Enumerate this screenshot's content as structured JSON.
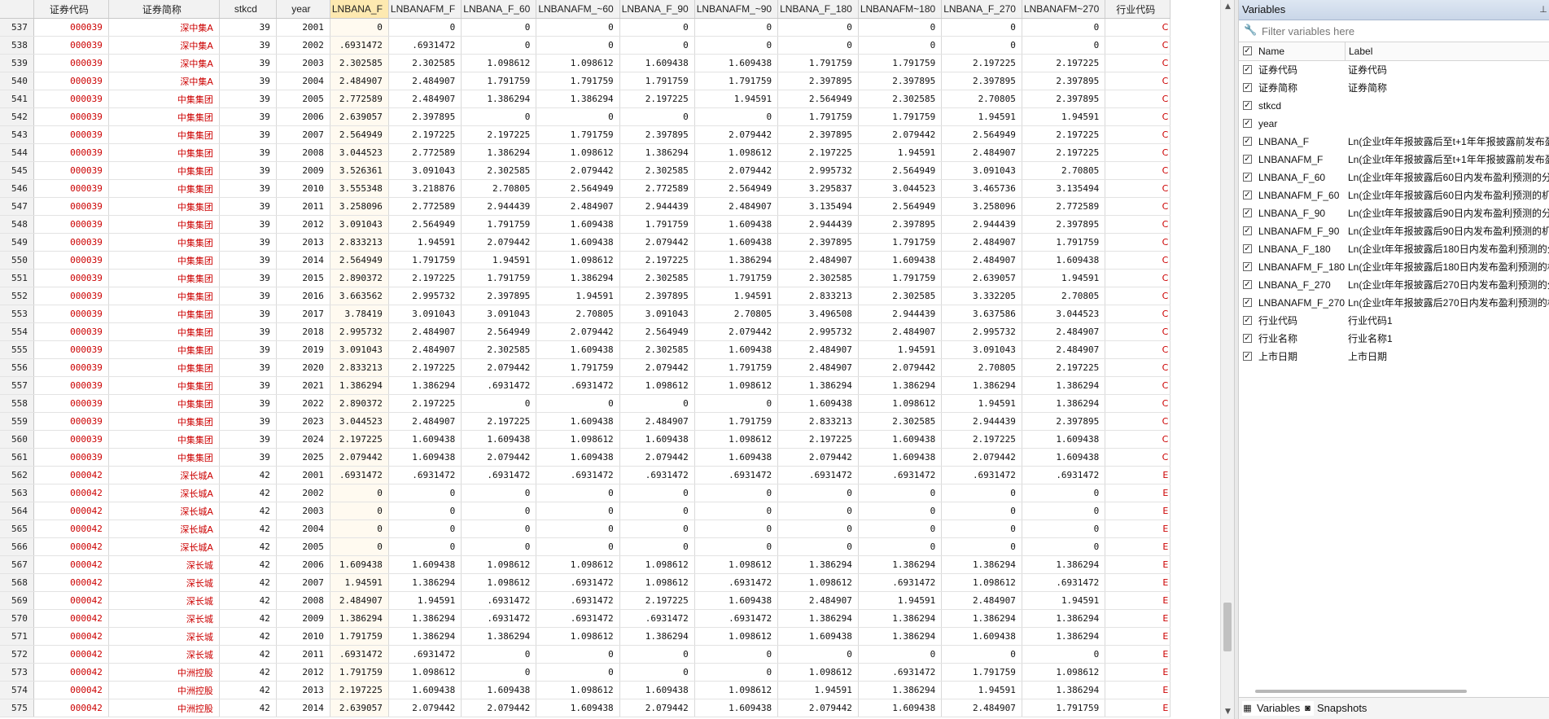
{
  "grid": {
    "columns": [
      "证券代码",
      "证券简称",
      "stkcd",
      "year",
      "LNBANA_F",
      "LNBANAFM_F",
      "LNBANA_F_60",
      "LNBANAFM_~60",
      "LNBANA_F_90",
      "LNBANAFM_~90",
      "LNBANA_F_180",
      "LNBANAFM~180",
      "LNBANA_F_270",
      "LNBANAFM~270",
      "行业代码"
    ],
    "selected_column": 4,
    "rows": [
      [
        "537",
        "000039",
        "深中集A",
        "39",
        "2001",
        "0",
        "0",
        "0",
        "0",
        "0",
        "0",
        "0",
        "0",
        "0",
        "0",
        "C"
      ],
      [
        "538",
        "000039",
        "深中集A",
        "39",
        "2002",
        ".6931472",
        ".6931472",
        "0",
        "0",
        "0",
        "0",
        "0",
        "0",
        "0",
        "0",
        "C"
      ],
      [
        "539",
        "000039",
        "深中集A",
        "39",
        "2003",
        "2.302585",
        "2.302585",
        "1.098612",
        "1.098612",
        "1.609438",
        "1.609438",
        "1.791759",
        "1.791759",
        "2.197225",
        "2.197225",
        "C"
      ],
      [
        "540",
        "000039",
        "深中集A",
        "39",
        "2004",
        "2.484907",
        "2.484907",
        "1.791759",
        "1.791759",
        "1.791759",
        "1.791759",
        "2.397895",
        "2.397895",
        "2.397895",
        "2.397895",
        "C"
      ],
      [
        "541",
        "000039",
        "中集集团",
        "39",
        "2005",
        "2.772589",
        "2.484907",
        "1.386294",
        "1.386294",
        "2.197225",
        "1.94591",
        "2.564949",
        "2.302585",
        "2.70805",
        "2.397895",
        "C"
      ],
      [
        "542",
        "000039",
        "中集集团",
        "39",
        "2006",
        "2.639057",
        "2.397895",
        "0",
        "0",
        "0",
        "0",
        "1.791759",
        "1.791759",
        "1.94591",
        "1.94591",
        "C"
      ],
      [
        "543",
        "000039",
        "中集集团",
        "39",
        "2007",
        "2.564949",
        "2.197225",
        "2.197225",
        "1.791759",
        "2.397895",
        "2.079442",
        "2.397895",
        "2.079442",
        "2.564949",
        "2.197225",
        "C"
      ],
      [
        "544",
        "000039",
        "中集集团",
        "39",
        "2008",
        "3.044523",
        "2.772589",
        "1.386294",
        "1.098612",
        "1.386294",
        "1.098612",
        "2.197225",
        "1.94591",
        "2.484907",
        "2.197225",
        "C"
      ],
      [
        "545",
        "000039",
        "中集集团",
        "39",
        "2009",
        "3.526361",
        "3.091043",
        "2.302585",
        "2.079442",
        "2.302585",
        "2.079442",
        "2.995732",
        "2.564949",
        "3.091043",
        "2.70805",
        "C"
      ],
      [
        "546",
        "000039",
        "中集集团",
        "39",
        "2010",
        "3.555348",
        "3.218876",
        "2.70805",
        "2.564949",
        "2.772589",
        "2.564949",
        "3.295837",
        "3.044523",
        "3.465736",
        "3.135494",
        "C"
      ],
      [
        "547",
        "000039",
        "中集集团",
        "39",
        "2011",
        "3.258096",
        "2.772589",
        "2.944439",
        "2.484907",
        "2.944439",
        "2.484907",
        "3.135494",
        "2.564949",
        "3.258096",
        "2.772589",
        "C"
      ],
      [
        "548",
        "000039",
        "中集集团",
        "39",
        "2012",
        "3.091043",
        "2.564949",
        "1.791759",
        "1.609438",
        "1.791759",
        "1.609438",
        "2.944439",
        "2.397895",
        "2.944439",
        "2.397895",
        "C"
      ],
      [
        "549",
        "000039",
        "中集集团",
        "39",
        "2013",
        "2.833213",
        "1.94591",
        "2.079442",
        "1.609438",
        "2.079442",
        "1.609438",
        "2.397895",
        "1.791759",
        "2.484907",
        "1.791759",
        "C"
      ],
      [
        "550",
        "000039",
        "中集集团",
        "39",
        "2014",
        "2.564949",
        "1.791759",
        "1.94591",
        "1.098612",
        "2.197225",
        "1.386294",
        "2.484907",
        "1.609438",
        "2.484907",
        "1.609438",
        "C"
      ],
      [
        "551",
        "000039",
        "中集集团",
        "39",
        "2015",
        "2.890372",
        "2.197225",
        "1.791759",
        "1.386294",
        "2.302585",
        "1.791759",
        "2.302585",
        "1.791759",
        "2.639057",
        "1.94591",
        "C"
      ],
      [
        "552",
        "000039",
        "中集集团",
        "39",
        "2016",
        "3.663562",
        "2.995732",
        "2.397895",
        "1.94591",
        "2.397895",
        "1.94591",
        "2.833213",
        "2.302585",
        "3.332205",
        "2.70805",
        "C"
      ],
      [
        "553",
        "000039",
        "中集集团",
        "39",
        "2017",
        "3.78419",
        "3.091043",
        "3.091043",
        "2.70805",
        "3.091043",
        "2.70805",
        "3.496508",
        "2.944439",
        "3.637586",
        "3.044523",
        "C"
      ],
      [
        "554",
        "000039",
        "中集集团",
        "39",
        "2018",
        "2.995732",
        "2.484907",
        "2.564949",
        "2.079442",
        "2.564949",
        "2.079442",
        "2.995732",
        "2.484907",
        "2.995732",
        "2.484907",
        "C"
      ],
      [
        "555",
        "000039",
        "中集集团",
        "39",
        "2019",
        "3.091043",
        "2.484907",
        "2.302585",
        "1.609438",
        "2.302585",
        "1.609438",
        "2.484907",
        "1.94591",
        "3.091043",
        "2.484907",
        "C"
      ],
      [
        "556",
        "000039",
        "中集集团",
        "39",
        "2020",
        "2.833213",
        "2.197225",
        "2.079442",
        "1.791759",
        "2.079442",
        "1.791759",
        "2.484907",
        "2.079442",
        "2.70805",
        "2.197225",
        "C"
      ],
      [
        "557",
        "000039",
        "中集集团",
        "39",
        "2021",
        "1.386294",
        "1.386294",
        ".6931472",
        ".6931472",
        "1.098612",
        "1.098612",
        "1.386294",
        "1.386294",
        "1.386294",
        "1.386294",
        "C"
      ],
      [
        "558",
        "000039",
        "中集集团",
        "39",
        "2022",
        "2.890372",
        "2.197225",
        "0",
        "0",
        "0",
        "0",
        "1.609438",
        "1.098612",
        "1.94591",
        "1.386294",
        "C"
      ],
      [
        "559",
        "000039",
        "中集集团",
        "39",
        "2023",
        "3.044523",
        "2.484907",
        "2.197225",
        "1.609438",
        "2.484907",
        "1.791759",
        "2.833213",
        "2.302585",
        "2.944439",
        "2.397895",
        "C"
      ],
      [
        "560",
        "000039",
        "中集集团",
        "39",
        "2024",
        "2.197225",
        "1.609438",
        "1.609438",
        "1.098612",
        "1.609438",
        "1.098612",
        "2.197225",
        "1.609438",
        "2.197225",
        "1.609438",
        "C"
      ],
      [
        "561",
        "000039",
        "中集集团",
        "39",
        "2025",
        "2.079442",
        "1.609438",
        "2.079442",
        "1.609438",
        "2.079442",
        "1.609438",
        "2.079442",
        "1.609438",
        "2.079442",
        "1.609438",
        "C"
      ],
      [
        "562",
        "000042",
        "深长城A",
        "42",
        "2001",
        ".6931472",
        ".6931472",
        ".6931472",
        ".6931472",
        ".6931472",
        ".6931472",
        ".6931472",
        ".6931472",
        ".6931472",
        ".6931472",
        "E"
      ],
      [
        "563",
        "000042",
        "深长城A",
        "42",
        "2002",
        "0",
        "0",
        "0",
        "0",
        "0",
        "0",
        "0",
        "0",
        "0",
        "0",
        "E"
      ],
      [
        "564",
        "000042",
        "深长城A",
        "42",
        "2003",
        "0",
        "0",
        "0",
        "0",
        "0",
        "0",
        "0",
        "0",
        "0",
        "0",
        "E"
      ],
      [
        "565",
        "000042",
        "深长城A",
        "42",
        "2004",
        "0",
        "0",
        "0",
        "0",
        "0",
        "0",
        "0",
        "0",
        "0",
        "0",
        "E"
      ],
      [
        "566",
        "000042",
        "深长城A",
        "42",
        "2005",
        "0",
        "0",
        "0",
        "0",
        "0",
        "0",
        "0",
        "0",
        "0",
        "0",
        "E"
      ],
      [
        "567",
        "000042",
        "深长城",
        "42",
        "2006",
        "1.609438",
        "1.609438",
        "1.098612",
        "1.098612",
        "1.098612",
        "1.098612",
        "1.386294",
        "1.386294",
        "1.386294",
        "1.386294",
        "E"
      ],
      [
        "568",
        "000042",
        "深长城",
        "42",
        "2007",
        "1.94591",
        "1.386294",
        "1.098612",
        ".6931472",
        "1.098612",
        ".6931472",
        "1.098612",
        ".6931472",
        "1.098612",
        ".6931472",
        "E"
      ],
      [
        "569",
        "000042",
        "深长城",
        "42",
        "2008",
        "2.484907",
        "1.94591",
        ".6931472",
        ".6931472",
        "2.197225",
        "1.609438",
        "2.484907",
        "1.94591",
        "2.484907",
        "1.94591",
        "E"
      ],
      [
        "570",
        "000042",
        "深长城",
        "42",
        "2009",
        "1.386294",
        "1.386294",
        ".6931472",
        ".6931472",
        ".6931472",
        ".6931472",
        "1.386294",
        "1.386294",
        "1.386294",
        "1.386294",
        "E"
      ],
      [
        "571",
        "000042",
        "深长城",
        "42",
        "2010",
        "1.791759",
        "1.386294",
        "1.386294",
        "1.098612",
        "1.386294",
        "1.098612",
        "1.609438",
        "1.386294",
        "1.609438",
        "1.386294",
        "E"
      ],
      [
        "572",
        "000042",
        "深长城",
        "42",
        "2011",
        ".6931472",
        ".6931472",
        "0",
        "0",
        "0",
        "0",
        "0",
        "0",
        "0",
        "0",
        "E"
      ],
      [
        "573",
        "000042",
        "中洲控股",
        "42",
        "2012",
        "1.791759",
        "1.098612",
        "0",
        "0",
        "0",
        "0",
        "1.098612",
        ".6931472",
        "1.791759",
        "1.098612",
        "E"
      ],
      [
        "574",
        "000042",
        "中洲控股",
        "42",
        "2013",
        "2.197225",
        "1.609438",
        "1.609438",
        "1.098612",
        "1.609438",
        "1.098612",
        "1.94591",
        "1.386294",
        "1.94591",
        "1.386294",
        "E"
      ],
      [
        "575",
        "000042",
        "中洲控股",
        "42",
        "2014",
        "2.639057",
        "2.079442",
        "2.079442",
        "1.609438",
        "2.079442",
        "1.609438",
        "2.079442",
        "1.609438",
        "2.484907",
        "1.791759",
        "E"
      ]
    ]
  },
  "variables_panel": {
    "title": "Variables",
    "pin_glyph": "📌",
    "filter_placeholder": "Filter variables here",
    "header": {
      "name": "Name",
      "label": "Label"
    },
    "items": [
      {
        "name": "证券代码",
        "label": "证券代码"
      },
      {
        "name": "证券简称",
        "label": "证券简称"
      },
      {
        "name": "stkcd",
        "label": ""
      },
      {
        "name": "year",
        "label": ""
      },
      {
        "name": "LNBANA_F",
        "label": "Ln(企业t年年报披露后至t+1年年报披露前发布盈"
      },
      {
        "name": "LNBANAFM_F",
        "label": "Ln(企业t年年报披露后至t+1年年报披露前发布盈"
      },
      {
        "name": "LNBANA_F_60",
        "label": "Ln(企业t年年报披露后60日内发布盈利预测的分"
      },
      {
        "name": "LNBANAFM_F_60",
        "label": "Ln(企业t年年报披露后60日内发布盈利预测的机"
      },
      {
        "name": "LNBANA_F_90",
        "label": "Ln(企业t年年报披露后90日内发布盈利预测的分"
      },
      {
        "name": "LNBANAFM_F_90",
        "label": "Ln(企业t年年报披露后90日内发布盈利预测的机"
      },
      {
        "name": "LNBANA_F_180",
        "label": "Ln(企业t年年报披露后180日内发布盈利预测的分"
      },
      {
        "name": "LNBANAFM_F_180",
        "label": "Ln(企业t年年报披露后180日内发布盈利预测的机"
      },
      {
        "name": "LNBANA_F_270",
        "label": "Ln(企业t年年报披露后270日内发布盈利预测的分"
      },
      {
        "name": "LNBANAFM_F_270",
        "label": "Ln(企业t年年报披露后270日内发布盈利预测的机"
      },
      {
        "name": "行业代码",
        "label": "行业代码1"
      },
      {
        "name": "行业名称",
        "label": "行业名称1"
      },
      {
        "name": "上市日期",
        "label": "上市日期"
      }
    ],
    "tabs": [
      {
        "label": "Variables",
        "icon": "variables-icon"
      },
      {
        "label": "Snapshots",
        "icon": "camera-icon"
      }
    ]
  },
  "colors": {
    "string_value": "#cc0000",
    "selected_header": "#fde9b0",
    "panel_title": "#c9d6e8"
  }
}
